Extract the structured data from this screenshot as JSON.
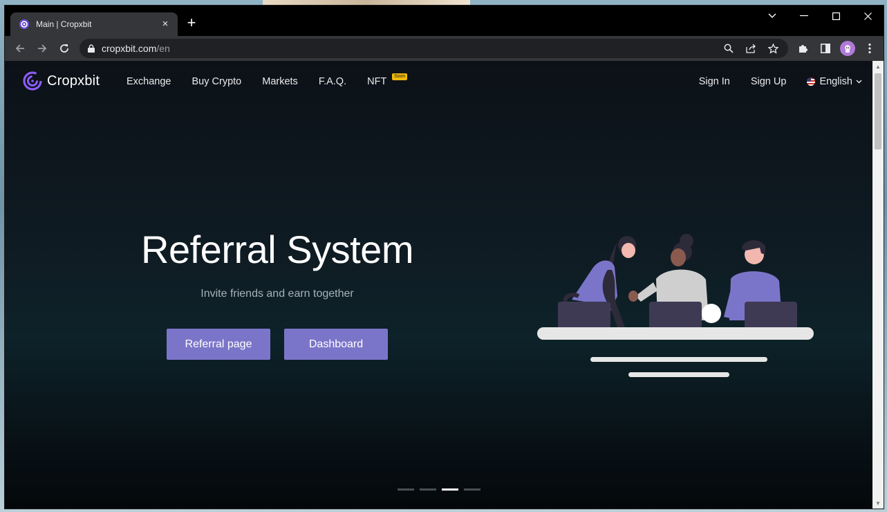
{
  "browser": {
    "tab_title": "Main | Cropxbit",
    "tab_close": "×",
    "new_tab": "+",
    "url_host": "cropxbit.com",
    "url_path": "/en"
  },
  "site": {
    "logo_text": "Cropxbit",
    "nav": {
      "exchange": "Exchange",
      "buy_crypto": "Buy Crypto",
      "markets": "Markets",
      "faq": "F.A.Q.",
      "nft": "NFT",
      "nft_badge": "Soon"
    },
    "sign_in": "Sign In",
    "sign_up": "Sign Up",
    "language": "English"
  },
  "hero": {
    "title": "Referral System",
    "subtitle": "Invite friends and earn together",
    "primary_button": "Referral page",
    "secondary_button": "Dashboard"
  },
  "carousel": {
    "slide_count": 4,
    "active_index": 2
  },
  "colors": {
    "accent": "#7b75c9",
    "badge": "#f0b90b",
    "logo": "#8b5cf6"
  }
}
